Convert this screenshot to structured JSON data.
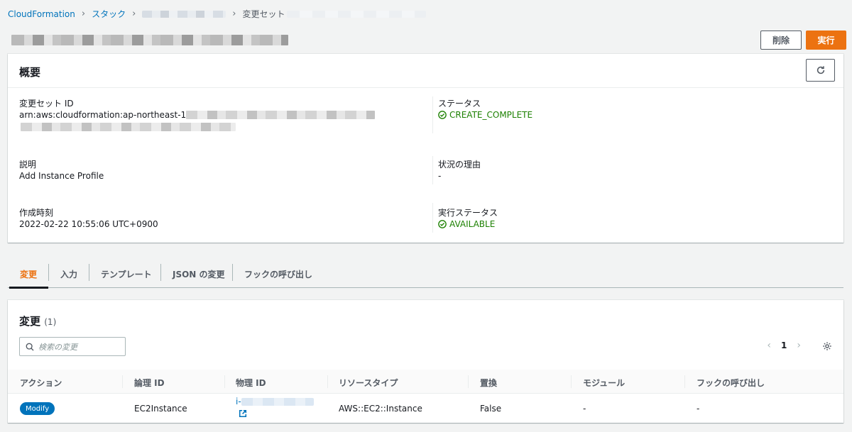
{
  "breadcrumb": {
    "item1": "CloudFormation",
    "item2": "スタック",
    "current": "変更セット"
  },
  "actions": {
    "delete_label": "削除",
    "execute_label": "実行"
  },
  "overview": {
    "title": "概要",
    "changeset_id_label": "変更セット ID",
    "changeset_id_prefix": "arn:aws:cloudformation:ap-northeast-1",
    "status_label": "ステータス",
    "status_value": "CREATE_COMPLETE",
    "description_label": "説明",
    "description_value": "Add Instance Profile",
    "status_reason_label": "状況の理由",
    "status_reason_value": "-",
    "created_label": "作成時刻",
    "created_value": "2022-02-22 10:55:06 UTC+0900",
    "execution_status_label": "実行ステータス",
    "execution_status_value": "AVAILABLE"
  },
  "tabs": [
    "変更",
    "入力",
    "テンプレート",
    "JSON の変更",
    "フックの呼び出し"
  ],
  "changes": {
    "title": "変更",
    "count": "(1)",
    "search_placeholder": "検索の変更",
    "page": "1",
    "columns": [
      "アクション",
      "論理 ID",
      "物理 ID",
      "リソースタイプ",
      "置換",
      "モジュール",
      "フックの呼び出し"
    ],
    "rows": [
      {
        "action": "Modify",
        "logical_id": "EC2Instance",
        "physical_id_prefix": "i-",
        "resource_type": "AWS::EC2::Instance",
        "replacement": "False",
        "module": "-",
        "hooks": "-"
      }
    ]
  },
  "colors": {
    "link": "#0073bb",
    "accent": "#ec7211",
    "success": "#1d8102"
  }
}
